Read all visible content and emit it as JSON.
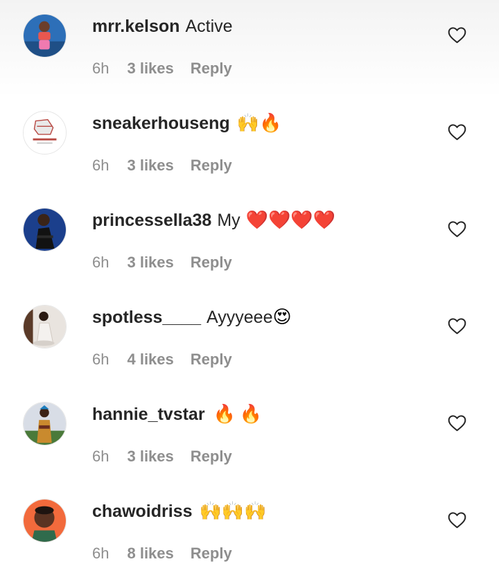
{
  "comments": [
    {
      "username": "mrr.kelson",
      "text": "Active",
      "emoji": "",
      "time": "6h",
      "likes": "3 likes",
      "reply": "Reply",
      "avatar_colors": [
        "#2d6fb8",
        "#e8574f"
      ]
    },
    {
      "username": "sneakerhouseng",
      "text": "",
      "emoji": "🙌🔥",
      "time": "6h",
      "likes": "3 likes",
      "reply": "Reply",
      "avatar_colors": [
        "#ffffff",
        "#b84a44"
      ]
    },
    {
      "username": "princessella38",
      "text": "My",
      "emoji": "❤️❤️❤️❤️",
      "time": "6h",
      "likes": "3 likes",
      "reply": "Reply",
      "avatar_colors": [
        "#1b3f8c",
        "#1a1a1a"
      ]
    },
    {
      "username": "spotless____",
      "text": "Ayyyeee",
      "emoji": "😍",
      "time": "6h",
      "likes": "4 likes",
      "reply": "Reply",
      "avatar_colors": [
        "#e9e4df",
        "#7a5a45"
      ]
    },
    {
      "username": "hannie_tvstar",
      "text": "",
      "emoji": "🔥🔥",
      "time": "6h",
      "likes": "3 likes",
      "reply": "Reply",
      "avatar_colors": [
        "#d8dde6",
        "#4a7a3a"
      ]
    },
    {
      "username": "chawoidriss",
      "text": "",
      "emoji": "🙌🙌🙌",
      "time": "6h",
      "likes": "8 likes",
      "reply": "Reply",
      "avatar_colors": [
        "#f26a3c",
        "#2f6b4c"
      ]
    }
  ],
  "colors": {
    "username": "#262626",
    "meta": "#8e8e8e",
    "heart": "#262626"
  }
}
